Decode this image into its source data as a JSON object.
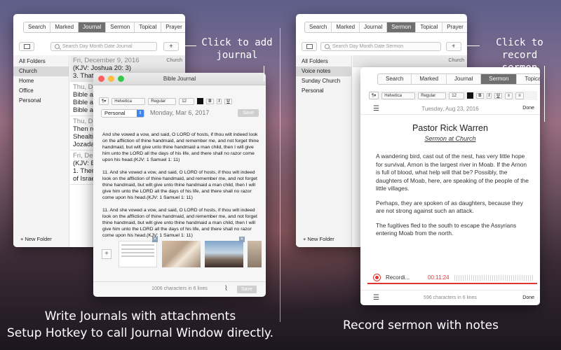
{
  "left_window": {
    "tabs": [
      "Search",
      "Marked",
      "Journal",
      "Sermon",
      "Topical",
      "Prayer"
    ],
    "active_tab": "Journal",
    "search_placeholder": "Search Day Month Date Journal",
    "add_label": "+",
    "folders": [
      "All Folders",
      "Church",
      "Home",
      "Office",
      "Personal"
    ],
    "selected_folder": "Church",
    "new_folder_label": "+ New Folder",
    "entries": [
      {
        "date": "Fri, December 9, 2016",
        "folder": "Church",
        "lines": [
          "(KJV: Joshua 20: 3)",
          "3. That"
        ]
      },
      {
        "date": "Thu, De",
        "folder": "",
        "lines": [
          "Bible ap",
          "Bible ap",
          "Bible ap"
        ]
      },
      {
        "date": "Thu, De",
        "folder": "",
        "lines": [
          "Then ro",
          "Shealtie",
          "Jozadal"
        ]
      },
      {
        "date": "Fri, De",
        "folder": "",
        "lines": [
          "(KJV: Ex",
          "1. Ther",
          "of Israe"
        ]
      }
    ]
  },
  "journal_window": {
    "title": "Bible Journal",
    "font": "Helvetica",
    "weight": "Regular",
    "size": "12",
    "bold": "B",
    "italic": "I",
    "underline": "U",
    "folder": "Personal",
    "date": "Monday, Mar 6, 2017",
    "save_label": "Save",
    "paragraphs": [
      "And she vowed a vow, and said, O LORD of hosts, if thou wilt indeed look on the affliction of thine handmaid, and remember me, and not forget thine handmaid, but wilt give unto thine handmaid a man child, then I will give him unto the LORD all the days of his life, and there shall no razor come upon his head.(KJV: 1 Samuel 1: 11)",
      "11. And she vowed a vow, and said, O LORD of hosts, if thou wilt indeed look on the affliction of thine handmaid, and remember me, and not forget thine handmaid, but wilt give unto thine handmaid a man child, then I will give him unto the LORD all the days of his life, and there shall no razor come upon his head.(KJV: 1 Samuel 1: 11)",
      "11. And she vowed a vow, and said, O LORD of hosts, if thou wilt indeed look on the affliction of thine handmaid, and remember me, and not forget thine handmaid, but wilt give unto thine handmaid a man child, then I will give him unto the LORD all the days of his life, and there shall no razor come upon his head.(KJV: 1 Samuel 1: 11)"
    ],
    "attachment_add": "+",
    "status": "1006 characters in 6 lines",
    "footer_save": "Save",
    "colors": {
      "close": "#fc605c",
      "min": "#fdbc40",
      "max": "#34c84a"
    }
  },
  "right_window": {
    "tabs": [
      "Search",
      "Marked",
      "Journal",
      "Sermon",
      "Topical",
      "Prayer"
    ],
    "active_tab": "Sermon",
    "search_placeholder": "Search Day Month Date Sermon",
    "add_label": "+",
    "folders": [
      "All Folders",
      "Voice notes",
      "Sunday Church",
      "Personal"
    ],
    "selected_folder": "Voice notes",
    "new_folder_label": "+ New Folder",
    "entry_folder": "Church"
  },
  "sermon_window": {
    "tabs": [
      "Search",
      "Marked",
      "Journal",
      "Sermon",
      "Topical"
    ],
    "active_tab": "Sermon",
    "font": "Helvetica",
    "weight": "Regular",
    "size": "12",
    "bold": "B",
    "italic": "I",
    "underline": "U",
    "date": "Tuesday, Aug 23, 2016",
    "done_label": "Done",
    "preacher": "Pastor Rick Warren",
    "place": "Sermon at Church",
    "paragraphs": [
      "A wandering bird, cast out of the nest, has very little hope for survival. Arnon is the largest river in Moab. If the Arnon is full of blood, what help will that be? Possibly, the daughters of Moab, here, are speaking of the people of the little villages.",
      "Perhaps, they are spoken of as daughters, because they are not strong against such an attack.",
      "The fugitives fled to the south to escape the Assyrians entering Moab from the north."
    ],
    "recording_label": "Recordi...",
    "recording_time": "00:11:24",
    "status": "596 characters in 6 lines",
    "footer_done": "Done",
    "colors": {
      "record": "#e0342f"
    }
  },
  "callouts": {
    "journal": [
      "Click to add",
      "journal"
    ],
    "sermon": [
      "Click to record",
      "sermon"
    ]
  },
  "captions": {
    "left": [
      "Write Journals with attachments",
      "Setup Hotkey to call Journal Window directly."
    ],
    "right": "Record sermon with notes"
  }
}
